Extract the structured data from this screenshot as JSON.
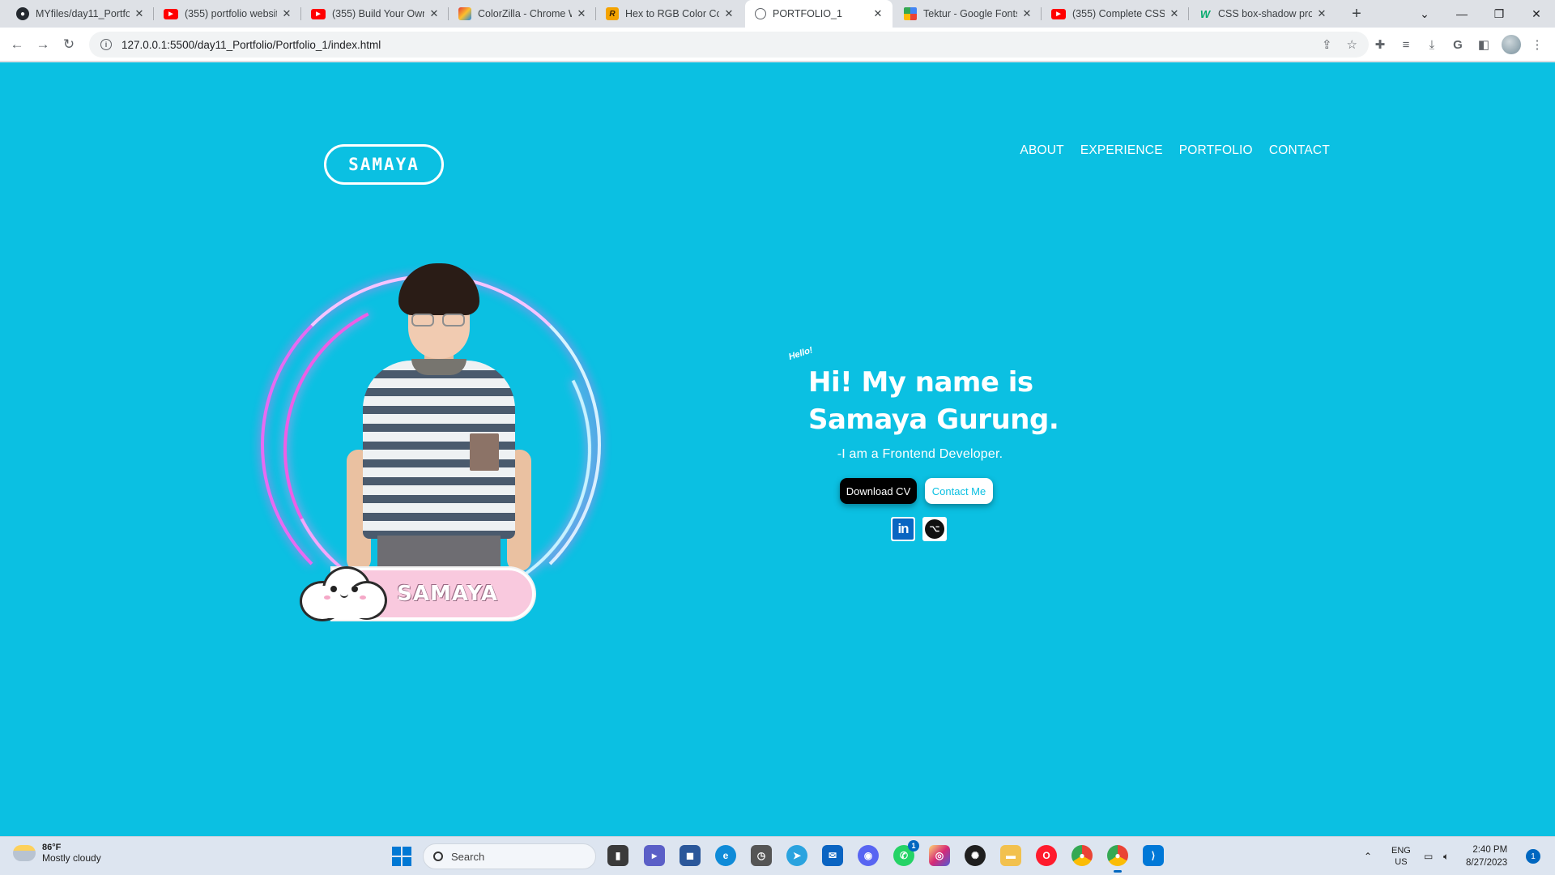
{
  "browser": {
    "tabs": [
      {
        "title": "MYfiles/day11_Portfolio",
        "favicon": "github-icon"
      },
      {
        "title": "(355) portfolio website",
        "favicon": "youtube-icon"
      },
      {
        "title": "(355) Build Your Own P",
        "favicon": "youtube-icon"
      },
      {
        "title": "ColorZilla - Chrome W",
        "favicon": "colorzilla-icon"
      },
      {
        "title": "Hex to RGB Color Con",
        "favicon": "rapidtables-icon"
      },
      {
        "title": "PORTFOLIO_1",
        "favicon": "globe-icon",
        "active": true
      },
      {
        "title": "Tektur - Google Fonts",
        "favicon": "google-fonts-icon"
      },
      {
        "title": "(355) Complete CSS G",
        "favicon": "youtube-icon"
      },
      {
        "title": "CSS box-shadow prop",
        "favicon": "w3schools-icon"
      }
    ],
    "url": "127.0.0.1:5500/day11_Portfolio/Portfolio_1/index.html"
  },
  "site": {
    "logo": "SAMAYA",
    "nav": [
      "ABOUT",
      "EXPERIENCE",
      "PORTFOLIO",
      "CONTACT"
    ],
    "hello": "Hello!",
    "headline_line1": "Hi! My name is",
    "headline_line2": "Samaya Gurung.",
    "tagline": "-I am a Frontend Developer.",
    "download_cv": "Download CV",
    "contact_me": "Contact Me",
    "nameplate": "SAMAYA",
    "background_color": "#0bc0e2"
  },
  "taskbar": {
    "weather_temp": "86°F",
    "weather_desc": "Mostly cloudy",
    "search_placeholder": "Search",
    "lang_top": "ENG",
    "lang_bottom": "US",
    "time": "2:40 PM",
    "date": "8/27/2023",
    "whatsapp_badge": "1",
    "notification_count": "1"
  }
}
